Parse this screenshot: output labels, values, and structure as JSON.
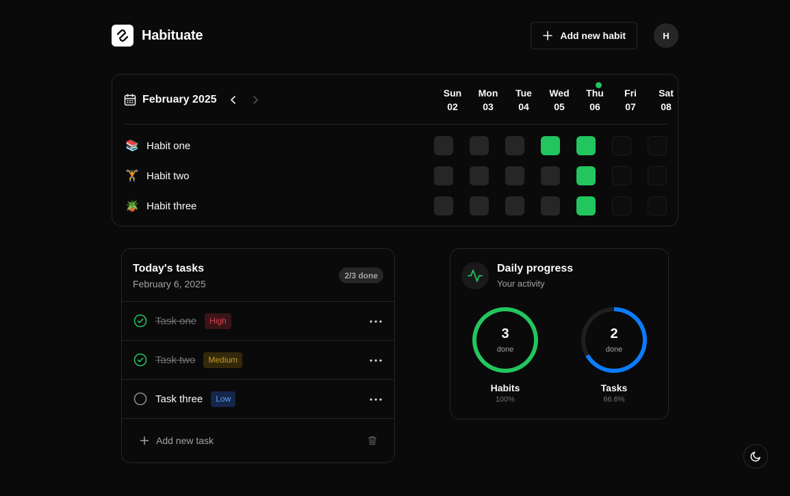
{
  "app": {
    "name": "Habituate",
    "logo_icon": "infinity-link-icon"
  },
  "header": {
    "add_habit_label": "Add new habit",
    "avatar_initial": "H"
  },
  "calendar": {
    "month": "February 2025",
    "days": [
      {
        "name": "Sun",
        "date": "02"
      },
      {
        "name": "Mon",
        "date": "03"
      },
      {
        "name": "Tue",
        "date": "04"
      },
      {
        "name": "Wed",
        "date": "05"
      },
      {
        "name": "Thu",
        "date": "06"
      },
      {
        "name": "Fri",
        "date": "07"
      },
      {
        "name": "Sat",
        "date": "08"
      }
    ],
    "today_index": 4,
    "habits": [
      {
        "emoji": "📚",
        "name": "Habit one",
        "completions": [
          false,
          false,
          false,
          true,
          true,
          null,
          null
        ]
      },
      {
        "emoji": "🏋",
        "name": "Habit two",
        "completions": [
          false,
          false,
          false,
          false,
          true,
          null,
          null
        ]
      },
      {
        "emoji": "🪴",
        "name": "Habit three",
        "completions": [
          false,
          false,
          false,
          false,
          true,
          null,
          null
        ]
      }
    ]
  },
  "tasks": {
    "title": "Today's tasks",
    "date": "February 6, 2025",
    "done_badge": "2/3 done",
    "items": [
      {
        "label": "Task one",
        "priority": "High",
        "done": true
      },
      {
        "label": "Task two",
        "priority": "Medium",
        "done": true
      },
      {
        "label": "Task three",
        "priority": "Low",
        "done": false
      }
    ],
    "add_label": "Add new task"
  },
  "progress": {
    "title": "Daily progress",
    "subtitle": "Your activity",
    "rings": [
      {
        "value": "3",
        "unit": "done",
        "label": "Habits",
        "percent_text": "100%",
        "fraction": 1.0,
        "color": "#22c55e"
      },
      {
        "value": "2",
        "unit": "done",
        "label": "Tasks",
        "percent_text": "66.6%",
        "fraction": 0.666,
        "color": "#0a7cff"
      }
    ]
  },
  "colors": {
    "accent_green": "#22c55e",
    "accent_blue": "#0a7cff",
    "background": "#0a0a0a",
    "border": "#262626"
  }
}
